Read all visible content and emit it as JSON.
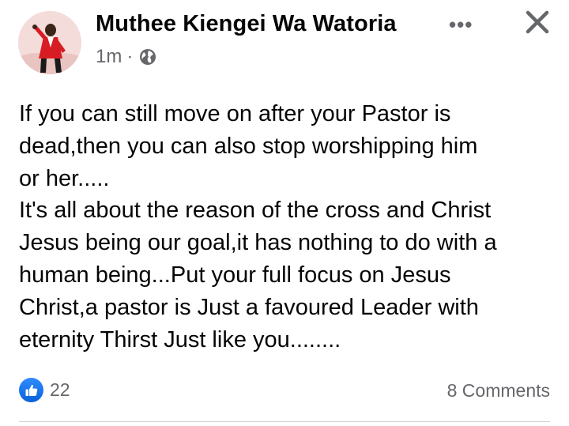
{
  "post": {
    "author_name": "Muthee Kiengei Wa Watoria",
    "timestamp": "1m",
    "separator": "·",
    "privacy_icon": "globe-icon",
    "more_icon": "more-options-icon",
    "more_glyph": "•••",
    "close_icon": "close-icon",
    "text_lines": [
      "If you can still move on after your Pastor is",
      "dead,then you can also stop worshipping him",
      "or her.....",
      "It's all about the reason of the cross and Christ",
      "Jesus being our goal,it has nothing to do with a",
      "human being...Put your full focus on Jesus",
      "Christ,a pastor is Just a favoured Leader with",
      "eternity Thirst Just like you........"
    ],
    "reaction_icon": "like-icon",
    "reaction_count": "22",
    "comments_label": "8 Comments"
  },
  "colors": {
    "text": "#050505",
    "secondary_text": "#65676b",
    "like_blue": "#1877f2",
    "divider": "#ced0d4"
  }
}
